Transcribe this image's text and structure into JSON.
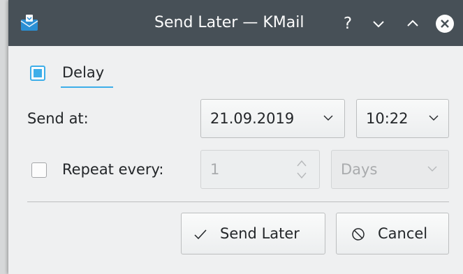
{
  "window": {
    "title": "Send Later — KMail",
    "help_glyph": "?",
    "app_icon": "kmail-envelope-icon"
  },
  "delay": {
    "label": "Delay",
    "checked": true
  },
  "send_at": {
    "label": "Send at:",
    "date": "21.09.2019",
    "time": "10:22"
  },
  "repeat": {
    "label": "Repeat every:",
    "checked": false,
    "value": "1",
    "unit": "Days"
  },
  "buttons": {
    "send_later": "Send Later",
    "cancel": "Cancel"
  },
  "colors": {
    "titlebar": "#475057",
    "accent": "#3daee9",
    "window_bg": "#eff0f1"
  }
}
